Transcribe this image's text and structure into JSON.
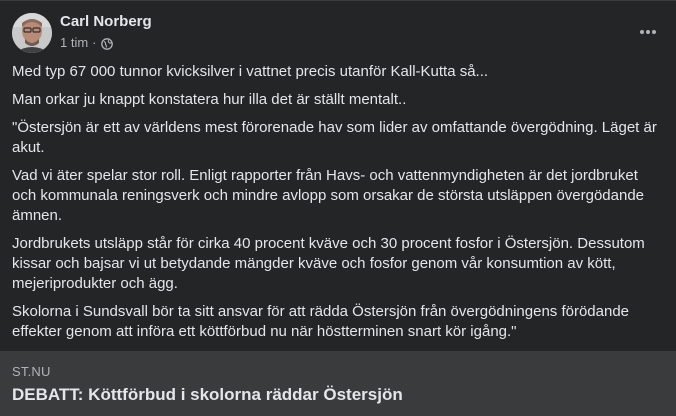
{
  "post": {
    "author": "Carl Norberg",
    "timestamp": "1 tim",
    "separator": "·",
    "audience_icon": "globe-icon",
    "more_icon": "more-horizontal-icon",
    "paragraphs": [
      "Med typ 67 000 tunnor kvicksilver i vattnet precis utanför Kall-Kutta så...",
      "Man orkar ju knappt konstatera hur illa det är ställt mentalt..",
      "\"Östersjön är ett av världens mest förorenade hav som lider av omfattande övergödning. Läget är akut.",
      "Vad vi äter spelar stor roll. Enligt rapporter från Havs- och vattenmyndigheten är det jordbruket och kommunala reningsverk och mindre avlopp som orsakar de största utsläppen övergödande ämnen.",
      "Jordbrukets utsläpp står för cirka 40 procent kväve och 30 procent fosfor i Östersjön. Dessutom kissar och bajsar vi ut betydande mängder kväve och fosfor genom vår konsumtion av kött, mejeriprodukter och ägg.",
      "Skolorna i Sundsvall bör ta sitt ansvar för att rädda Östersjön från övergödningens förödande effekter genom att införa ett köttförbud nu när höstterminen snart kör igång.\""
    ]
  },
  "link_preview": {
    "domain": "ST.NU",
    "title": "DEBATT: Köttförbud i skolorna räddar Östersjön"
  },
  "colors": {
    "background": "#242526",
    "card": "#3a3b3c",
    "text_primary": "#e4e6eb",
    "text_secondary": "#b0b3b8"
  }
}
